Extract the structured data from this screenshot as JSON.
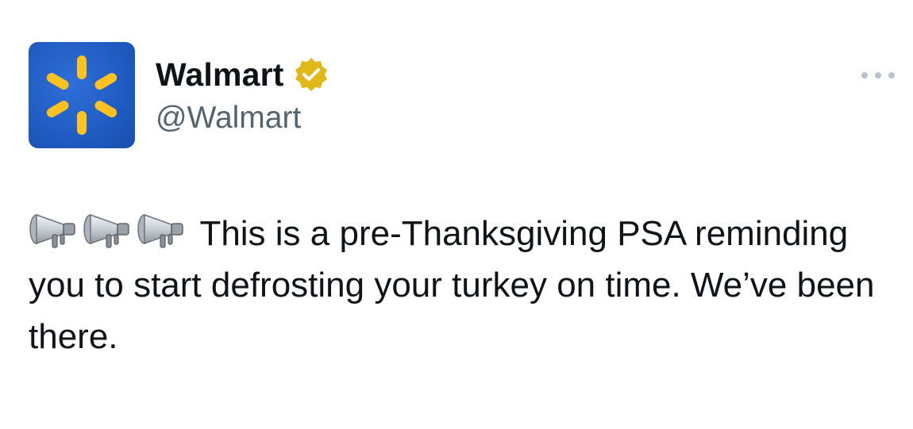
{
  "author": {
    "display_name": "Walmart",
    "handle": "@Walmart",
    "verified_badge_icon": "gold-verified-badge-icon",
    "avatar_icon": "walmart-spark-logo-icon",
    "avatar_bg_color": "#1f5bc2",
    "spark_color": "#ffc220",
    "verified_color": "#e2b719"
  },
  "menu": {
    "more_icon": "more-dots-icon"
  },
  "post": {
    "emoji_icon": "loudspeaker-emoji-icon",
    "emoji_count": 3,
    "text": "This is a pre-Thanksgiving PSA reminding you to start defrosting your turkey on time. We’ve been there."
  }
}
